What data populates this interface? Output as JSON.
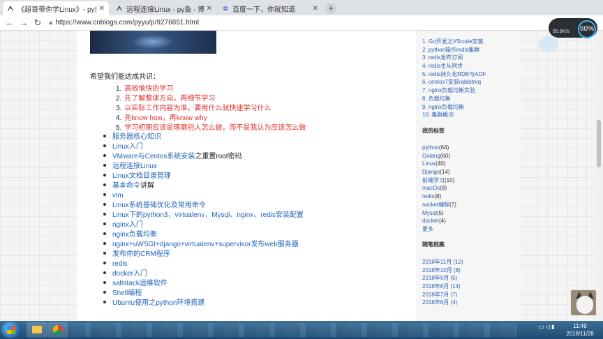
{
  "tabs": [
    {
      "title": "《超哥带你学Linux》- py鱼 - 博",
      "favicon": "A",
      "active": true
    },
    {
      "title": "远程连接Linux - py鱼 - 博客园",
      "favicon": "A",
      "active": false
    },
    {
      "title": "百度一下，你就知道",
      "favicon": "paw",
      "active": false
    }
  ],
  "toolbar": {
    "url": "https://www.cnblogs.com/pyyu/p/9276851.html"
  },
  "article": {
    "intro": "希望我们能达成共识：",
    "goals": [
      "高效愉快的学习",
      "先了解整体方向，再细节学习",
      "以实际工作内容为准，要用什么就快速学习什么",
      "先know how，再know why",
      "学习初期应该是琢磨别人怎么做，而不是我认为应该怎么做"
    ],
    "links": [
      {
        "text": "服务器核心知识",
        "suffix": ""
      },
      {
        "text": "Linux入门",
        "suffix": ""
      },
      {
        "text": "VMware与Centos系统安装",
        "suffix": "之重置root密码"
      },
      {
        "text": "远程连接Linux",
        "suffix": ""
      },
      {
        "text": "Linux文档目录管理",
        "suffix": ""
      },
      {
        "text": "基本命令",
        "suffix": "讲解"
      },
      {
        "text": "vim",
        "suffix": ""
      },
      {
        "text": "Linux系统基础优化及常用命令",
        "suffix": ""
      },
      {
        "text": "Linux下的python3，virtualenv，Mysql、nginx、redis安装配置",
        "suffix": ""
      },
      {
        "text": "nginx入门",
        "suffix": ""
      },
      {
        "text": "nginx负载均衡",
        "suffix": ""
      },
      {
        "text": "nginx+uWSGI+django+virtualenv+supervisor发布web服务器",
        "suffix": ""
      },
      {
        "text": "发布你的CRM程序",
        "suffix": ""
      },
      {
        "text": "redis",
        "suffix": ""
      },
      {
        "text": "docker入门",
        "suffix": ""
      },
      {
        "text": "saltstack运维软件",
        "suffix": ""
      },
      {
        "text": "Shell编程",
        "suffix": ""
      },
      {
        "text": "Ubuntu使用之python环境搭建",
        "suffix": ""
      }
    ]
  },
  "sidebar": {
    "recent_posts": [
      "1. Go开发之VScode安装",
      "2. python操作redis集群",
      "3. redis发布订阅",
      "4. redis主从同步",
      "5. redis持久化RDB与AOF",
      "6. centos7安装rabbitmq",
      "7. nginx负载均衡实验",
      "8. 负载均衡",
      "9. nginx负载均衡",
      "10. 集群概念"
    ],
    "tags_heading": "我的标签",
    "tags": [
      {
        "name": "python",
        "count": "(64)"
      },
      {
        "name": "Golang",
        "count": "(60)"
      },
      {
        "name": "Linux",
        "count": "(40)"
      },
      {
        "name": "Django",
        "count": "(14)"
      },
      {
        "name": "前端学习",
        "count": "(10)"
      },
      {
        "name": "macOs",
        "count": "(8)"
      },
      {
        "name": "redis",
        "count": "(8)"
      },
      {
        "name": "socket编程",
        "count": "(7)"
      },
      {
        "name": "Mysql",
        "count": "(5)"
      },
      {
        "name": "docker",
        "count": "(4)"
      }
    ],
    "tags_more": "更多",
    "archive_heading": "随笔档案",
    "archives": [
      "2018年11月 (12)",
      "2018年10月 (8)",
      "2018年9月 (5)",
      "2018年8月 (14)",
      "2018年7月 (7)",
      "2018年6月 (4)"
    ]
  },
  "overlay": {
    "net_rate": "95.9K/s",
    "percent": "60%"
  },
  "taskbar": {
    "time": "11:49",
    "date": "2018/11/28"
  }
}
